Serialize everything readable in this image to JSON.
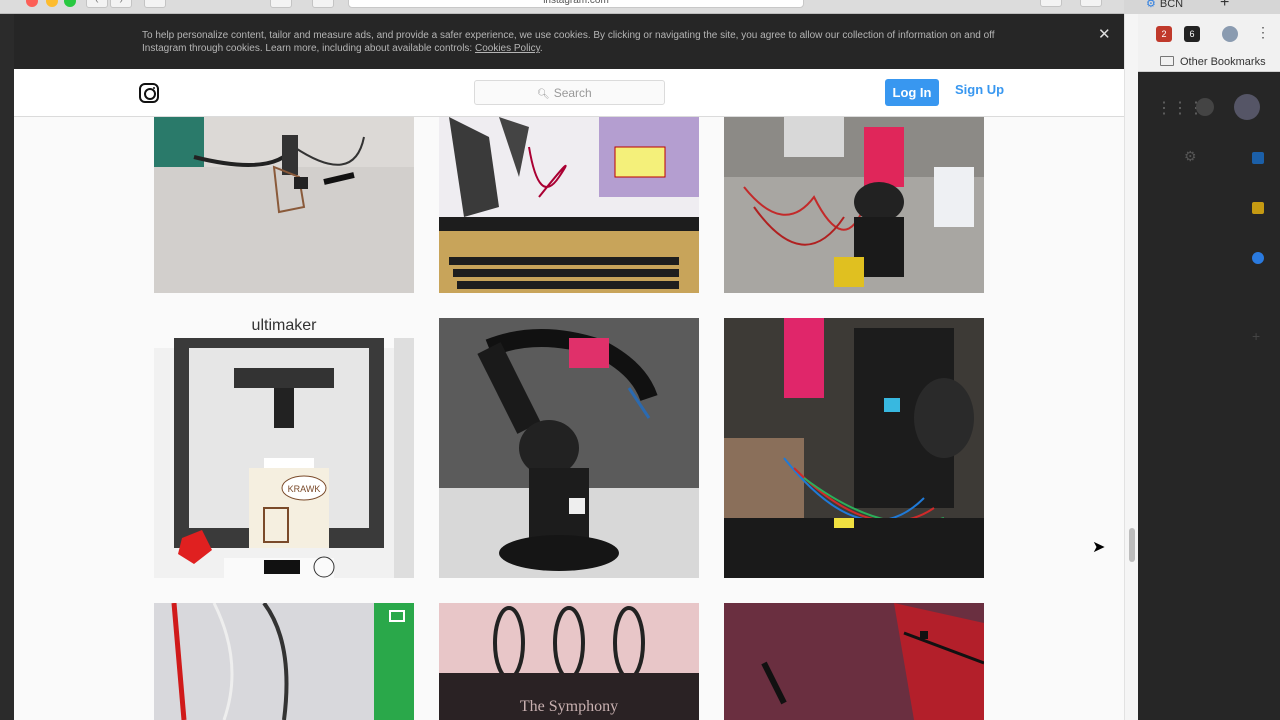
{
  "browser": {
    "url": "instagram.com",
    "side_tab_label": "BCN",
    "bookmarks_label": "Other Bookmarks",
    "ext_badge_1": "2",
    "ext_badge_2": "6"
  },
  "cookie_banner": {
    "text": "To help personalize content, tailor and measure ads, and provide a safer experience, we use cookies. By clicking or navigating the site, you agree to allow our collection of information on and off Instagram through cookies. Learn more, including about available controls:",
    "link_label": "Cookies Policy",
    "close_label": "✕"
  },
  "header": {
    "search_placeholder": "Search",
    "login_label": "Log In",
    "signup_label": "Sign Up"
  },
  "posts": [
    {
      "alt": "Circuit board with sensor and cables"
    },
    {
      "alt": "Robot arm toolpath simulation on laptop"
    },
    {
      "alt": "Robot arm wired on desk with laptop"
    },
    {
      "alt": "Ultimaker 3D printer with KRAWK print"
    },
    {
      "alt": "Black and pink robotic arm"
    },
    {
      "alt": "Robot arm base with wiring"
    },
    {
      "alt": "Wires and electronics board"
    },
    {
      "alt": "The Symphony sign with rings"
    },
    {
      "alt": "Dark red scene with rod"
    }
  ],
  "tile_text": {
    "ultimaker": "ultimaker",
    "krawk": "KRAWK",
    "symphony": "The Symphony"
  }
}
